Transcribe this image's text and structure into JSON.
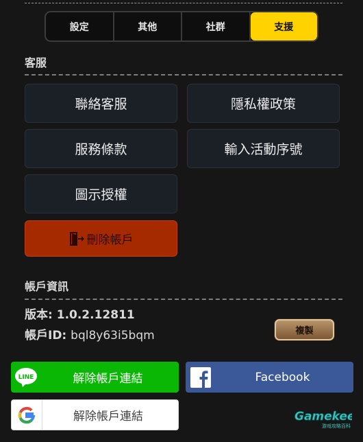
{
  "tabs": [
    {
      "label": "設定",
      "active": false
    },
    {
      "label": "其他",
      "active": false
    },
    {
      "label": "社群",
      "active": false
    },
    {
      "label": "支援",
      "active": true
    }
  ],
  "support": {
    "title": "客服",
    "contact": "聯絡客服",
    "privacy": "隱私權政策",
    "terms": "服務條款",
    "redeem": "輸入活動序號",
    "icon_license": "圖示授權",
    "delete_account": "刪除帳戶"
  },
  "account": {
    "title": "帳戶資訊",
    "version_label": "版本:",
    "version": "1.0.2.12811",
    "id_label": "帳戶ID:",
    "id": "bql8y63i5bqm",
    "copy": "複製"
  },
  "social": {
    "line_label": "解除帳戶連結",
    "line_icon_text": "LINE",
    "facebook_label": "Facebook",
    "google_label": "解除帳戶連結"
  },
  "watermark": {
    "brand": "Gamekee",
    "sub": "游戏攻略百科"
  },
  "colors": {
    "accent": "#ffd200",
    "delete": "#a52a00",
    "line": "#0bb705",
    "facebook": "#3b5998"
  }
}
